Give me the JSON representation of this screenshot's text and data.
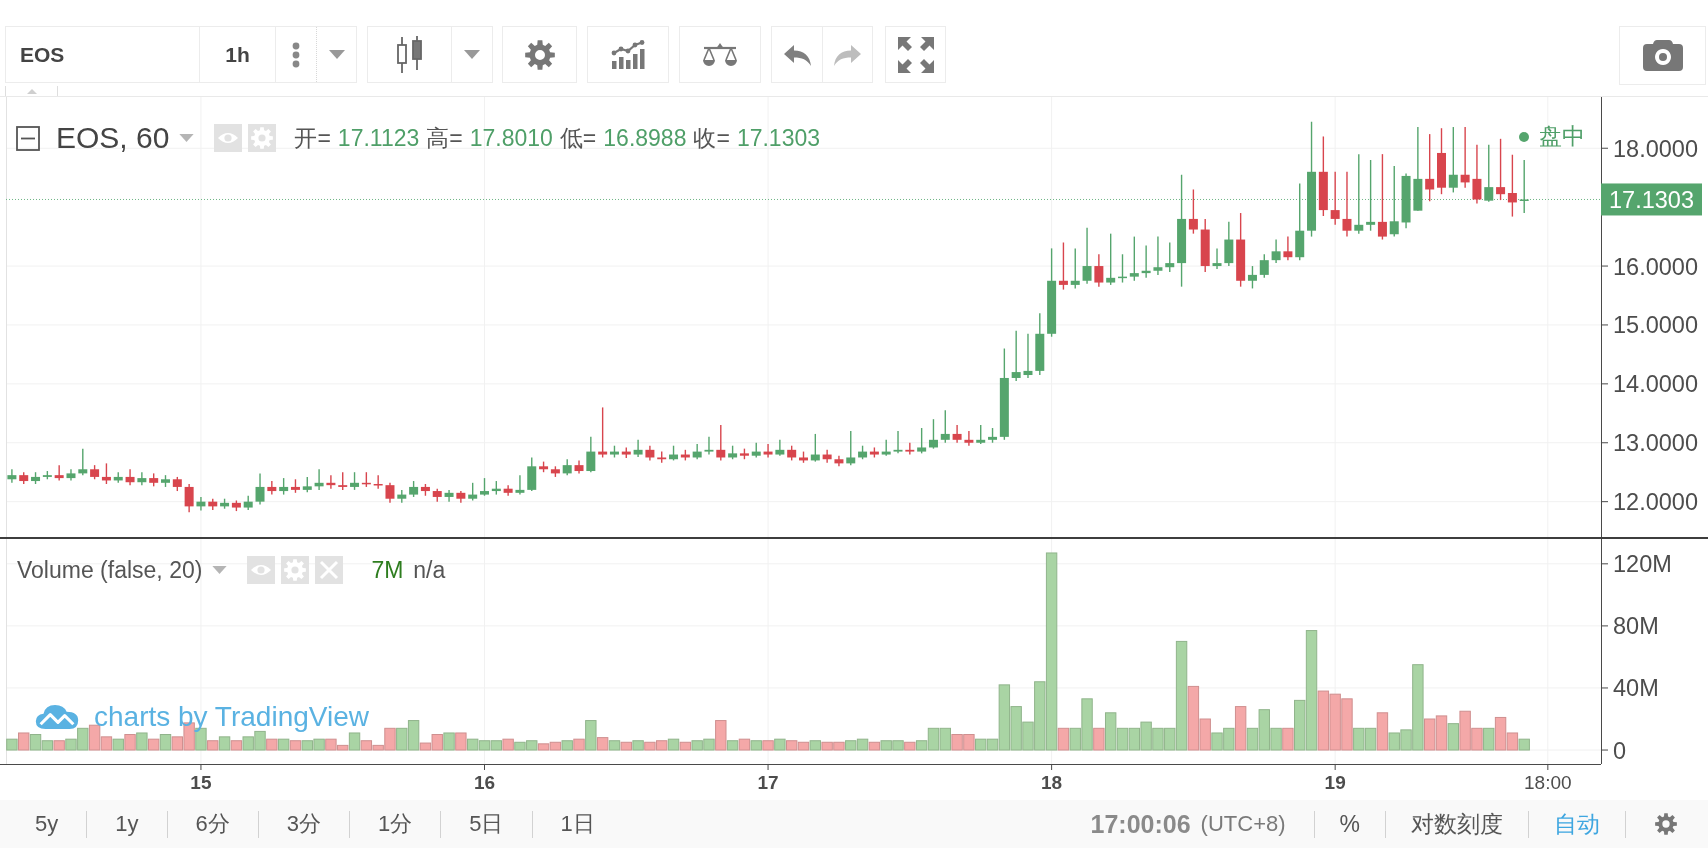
{
  "toolbar": {
    "symbol": "EOS",
    "interval": "1h",
    "undo": {
      "disabled": false
    },
    "redo": {
      "disabled": true
    }
  },
  "price_pane": {
    "legend": {
      "symbol": "EOS, 60",
      "fields": [
        {
          "label": "开=",
          "value": "17.1123"
        },
        {
          "label": "高=",
          "value": "17.8010"
        },
        {
          "label": "低=",
          "value": "16.8988"
        },
        {
          "label": "收=",
          "value": "17.1303"
        }
      ]
    },
    "market_status": "盘中",
    "chart_data": {
      "type": "candlestick",
      "grid": true,
      "ylim": [
        11.4,
        18.87
      ],
      "yticks": [
        {
          "value": 18,
          "label": "18.0000"
        },
        {
          "value": 16,
          "label": "16.0000"
        },
        {
          "value": 15,
          "label": "15.0000"
        },
        {
          "value": 14,
          "label": "14.0000"
        },
        {
          "value": 13,
          "label": "13.0000"
        },
        {
          "value": 12,
          "label": "12.0000"
        }
      ],
      "ref_lines": [
        {
          "axis": "y",
          "value": 17.1303,
          "label": "17.1303"
        }
      ],
      "categories": [
        null,
        null,
        null,
        null,
        null,
        null,
        null,
        null,
        null,
        null,
        null,
        null,
        null,
        null,
        null,
        null,
        null,
        null,
        null,
        null,
        null,
        null,
        null,
        null,
        null,
        null,
        null,
        null,
        null,
        null,
        null,
        null,
        null,
        null,
        null,
        null,
        null,
        null,
        null,
        null,
        null,
        null,
        null,
        null,
        null,
        null,
        null,
        null,
        null,
        null,
        null,
        null,
        null,
        null,
        null,
        null,
        null,
        null,
        null,
        null,
        null,
        null,
        null,
        null,
        null,
        null,
        null,
        null,
        null,
        null,
        null,
        null,
        null,
        null,
        null,
        null,
        null,
        null,
        null,
        null,
        null,
        null,
        null,
        null,
        null,
        null,
        null,
        null,
        null,
        null,
        null,
        null,
        null,
        null,
        null,
        null,
        null,
        null,
        null,
        null,
        null,
        null,
        null,
        null,
        null,
        null,
        null,
        null,
        null,
        null,
        null,
        null,
        null,
        null,
        null,
        null,
        null,
        null,
        null,
        null,
        null,
        null,
        null,
        null,
        null,
        null,
        null,
        null,
        null,
        null,
        null,
        null,
        null,
        null,
        null
      ],
      "ohlc": [
        [
          12.38,
          12.55,
          12.32,
          12.45
        ],
        [
          12.45,
          12.5,
          12.3,
          12.35
        ],
        [
          12.35,
          12.5,
          12.3,
          12.42
        ],
        [
          12.42,
          12.52,
          12.38,
          12.45
        ],
        [
          12.45,
          12.62,
          12.36,
          12.4
        ],
        [
          12.4,
          12.55,
          12.36,
          12.48
        ],
        [
          12.48,
          12.9,
          12.45,
          12.55
        ],
        [
          12.55,
          12.62,
          12.38,
          12.42
        ],
        [
          12.42,
          12.65,
          12.3,
          12.36
        ],
        [
          12.36,
          12.5,
          12.32,
          12.42
        ],
        [
          12.42,
          12.55,
          12.28,
          12.33
        ],
        [
          12.33,
          12.5,
          12.28,
          12.4
        ],
        [
          12.4,
          12.48,
          12.26,
          12.32
        ],
        [
          12.32,
          12.45,
          12.25,
          12.38
        ],
        [
          12.38,
          12.42,
          12.18,
          12.25
        ],
        [
          12.25,
          12.3,
          11.82,
          11.92
        ],
        [
          11.92,
          12.08,
          11.85,
          12.0
        ],
        [
          12.0,
          12.05,
          11.86,
          11.92
        ],
        [
          11.92,
          12.05,
          11.88,
          11.98
        ],
        [
          11.98,
          12.02,
          11.84,
          11.9
        ],
        [
          11.9,
          12.1,
          11.86,
          12.0
        ],
        [
          12.0,
          12.48,
          11.95,
          12.25
        ],
        [
          12.25,
          12.35,
          12.12,
          12.18
        ],
        [
          12.18,
          12.4,
          12.12,
          12.25
        ],
        [
          12.25,
          12.38,
          12.15,
          12.2
        ],
        [
          12.2,
          12.42,
          12.16,
          12.26
        ],
        [
          12.26,
          12.55,
          12.2,
          12.32
        ],
        [
          12.32,
          12.45,
          12.22,
          12.28
        ],
        [
          12.28,
          12.5,
          12.2,
          12.25
        ],
        [
          12.25,
          12.5,
          12.2,
          12.32
        ],
        [
          12.32,
          12.5,
          12.25,
          12.3
        ],
        [
          12.3,
          12.45,
          12.22,
          12.28
        ],
        [
          12.28,
          12.32,
          11.98,
          12.05
        ],
        [
          12.05,
          12.2,
          11.98,
          12.12
        ],
        [
          12.12,
          12.35,
          12.08,
          12.25
        ],
        [
          12.25,
          12.3,
          12.1,
          12.18
        ],
        [
          12.18,
          12.22,
          12.0,
          12.08
        ],
        [
          12.08,
          12.2,
          12.0,
          12.15
        ],
        [
          12.15,
          12.18,
          11.98,
          12.05
        ],
        [
          12.05,
          12.32,
          12.02,
          12.12
        ],
        [
          12.12,
          12.4,
          12.1,
          12.18
        ],
        [
          12.18,
          12.35,
          12.12,
          12.22
        ],
        [
          12.22,
          12.28,
          12.1,
          12.15
        ],
        [
          12.15,
          12.45,
          12.12,
          12.2
        ],
        [
          12.2,
          12.75,
          12.18,
          12.6
        ],
        [
          12.6,
          12.68,
          12.5,
          12.55
        ],
        [
          12.55,
          12.6,
          12.42,
          12.48
        ],
        [
          12.48,
          12.72,
          12.45,
          12.62
        ],
        [
          12.62,
          12.7,
          12.48,
          12.52
        ],
        [
          12.52,
          13.1,
          12.5,
          12.85
        ],
        [
          12.85,
          13.6,
          12.75,
          12.8
        ],
        [
          12.8,
          12.95,
          12.75,
          12.85
        ],
        [
          12.85,
          12.92,
          12.74,
          12.8
        ],
        [
          12.8,
          13.05,
          12.76,
          12.88
        ],
        [
          12.88,
          12.95,
          12.7,
          12.75
        ],
        [
          12.75,
          12.85,
          12.66,
          12.72
        ],
        [
          12.72,
          12.95,
          12.7,
          12.8
        ],
        [
          12.8,
          12.88,
          12.7,
          12.75
        ],
        [
          12.75,
          12.98,
          12.72,
          12.85
        ],
        [
          12.85,
          13.1,
          12.8,
          12.88
        ],
        [
          12.88,
          13.3,
          12.7,
          12.75
        ],
        [
          12.75,
          12.95,
          12.72,
          12.82
        ],
        [
          12.82,
          12.9,
          12.72,
          12.78
        ],
        [
          12.78,
          13.0,
          12.75,
          12.85
        ],
        [
          12.85,
          12.98,
          12.75,
          12.8
        ],
        [
          12.8,
          13.05,
          12.78,
          12.88
        ],
        [
          12.88,
          12.95,
          12.7,
          12.75
        ],
        [
          12.75,
          12.85,
          12.66,
          12.7
        ],
        [
          12.7,
          13.15,
          12.68,
          12.8
        ],
        [
          12.8,
          12.88,
          12.66,
          12.72
        ],
        [
          12.72,
          12.78,
          12.6,
          12.65
        ],
        [
          12.65,
          13.2,
          12.62,
          12.75
        ],
        [
          12.75,
          12.95,
          12.72,
          12.85
        ],
        [
          12.85,
          12.92,
          12.75,
          12.8
        ],
        [
          12.8,
          13.05,
          12.78,
          12.85
        ],
        [
          12.85,
          13.2,
          12.82,
          12.88
        ],
        [
          12.88,
          13.0,
          12.8,
          12.85
        ],
        [
          12.85,
          13.25,
          12.82,
          12.92
        ],
        [
          12.92,
          13.4,
          12.9,
          13.05
        ],
        [
          13.05,
          13.55,
          13.0,
          13.15
        ],
        [
          13.15,
          13.3,
          13.0,
          13.05
        ],
        [
          13.05,
          13.2,
          12.95,
          13.0
        ],
        [
          13.0,
          13.3,
          12.98,
          13.05
        ],
        [
          13.05,
          13.25,
          13.0,
          13.1
        ],
        [
          13.1,
          14.6,
          13.05,
          14.1
        ],
        [
          14.1,
          14.9,
          14.05,
          14.2
        ],
        [
          14.15,
          14.85,
          14.1,
          14.22
        ],
        [
          14.22,
          15.2,
          14.15,
          14.85
        ],
        [
          14.85,
          16.3,
          14.8,
          15.75
        ],
        [
          15.75,
          16.4,
          15.6,
          15.68
        ],
        [
          15.68,
          16.3,
          15.62,
          15.75
        ],
        [
          15.75,
          16.65,
          15.7,
          16.0
        ],
        [
          16.0,
          16.2,
          15.65,
          15.72
        ],
        [
          15.72,
          16.55,
          15.68,
          15.8
        ],
        [
          15.8,
          16.2,
          15.72,
          15.82
        ],
        [
          15.82,
          16.5,
          15.75,
          15.88
        ],
        [
          15.88,
          16.35,
          15.8,
          15.92
        ],
        [
          15.92,
          16.5,
          15.85,
          15.98
        ],
        [
          15.98,
          16.4,
          15.9,
          16.05
        ],
        [
          16.05,
          17.55,
          15.65,
          16.8
        ],
        [
          16.8,
          17.3,
          16.55,
          16.62
        ],
        [
          16.62,
          16.8,
          15.9,
          16.0
        ],
        [
          16.0,
          16.3,
          15.95,
          16.05
        ],
        [
          16.05,
          16.75,
          16.0,
          16.45
        ],
        [
          16.45,
          16.9,
          15.65,
          15.75
        ],
        [
          15.75,
          16.0,
          15.62,
          15.85
        ],
        [
          15.85,
          16.2,
          15.8,
          16.1
        ],
        [
          16.1,
          16.45,
          16.05,
          16.25
        ],
        [
          16.25,
          16.5,
          16.1,
          16.15
        ],
        [
          16.15,
          17.4,
          16.1,
          16.6
        ],
        [
          16.6,
          18.45,
          16.5,
          17.6
        ],
        [
          17.6,
          18.2,
          16.85,
          16.95
        ],
        [
          16.95,
          17.6,
          16.7,
          16.8
        ],
        [
          16.8,
          17.6,
          16.5,
          16.6
        ],
        [
          16.6,
          17.9,
          16.55,
          16.7
        ],
        [
          16.7,
          17.8,
          16.6,
          16.75
        ],
        [
          16.75,
          17.9,
          16.45,
          16.5
        ],
        [
          16.54,
          17.7,
          16.5,
          16.76
        ],
        [
          16.74,
          17.57,
          16.64,
          17.53
        ],
        [
          16.94,
          18.36,
          16.94,
          17.48
        ],
        [
          17.48,
          18.24,
          17.1,
          17.3
        ],
        [
          17.92,
          18.34,
          17.22,
          17.33
        ],
        [
          17.33,
          18.36,
          17.25,
          17.55
        ],
        [
          17.55,
          18.36,
          17.33,
          17.42
        ],
        [
          17.48,
          18.06,
          17.06,
          17.13
        ],
        [
          17.11,
          18.06,
          17.09,
          17.34
        ],
        [
          17.34,
          18.16,
          17.12,
          17.22
        ],
        [
          17.24,
          17.89,
          16.84,
          17.08
        ],
        [
          17.1123,
          17.801,
          16.8988,
          17.1303
        ],
        null,
        null,
        null,
        null,
        null,
        null
      ]
    }
  },
  "volume_pane": {
    "legend": {
      "title": "Volume (false, 20)",
      "value": "7M",
      "extra": "n/a"
    },
    "chart_data": {
      "type": "bar",
      "stacked": true,
      "grid": true,
      "ylim": [
        -9,
        136
      ],
      "categories": [
        null,
        null,
        null,
        null,
        null,
        null,
        null,
        null,
        null,
        null,
        null,
        null,
        null,
        null,
        null,
        null,
        "15",
        null,
        null,
        null,
        null,
        null,
        null,
        null,
        null,
        null,
        null,
        null,
        null,
        null,
        null,
        null,
        null,
        null,
        null,
        null,
        null,
        null,
        null,
        null,
        "16",
        null,
        null,
        null,
        null,
        null,
        null,
        null,
        null,
        null,
        null,
        null,
        null,
        null,
        null,
        null,
        null,
        null,
        null,
        null,
        null,
        null,
        null,
        null,
        "17",
        null,
        null,
        null,
        null,
        null,
        null,
        null,
        null,
        null,
        null,
        null,
        null,
        null,
        null,
        null,
        null,
        null,
        null,
        null,
        null,
        null,
        null,
        null,
        "18",
        null,
        null,
        null,
        null,
        null,
        null,
        null,
        null,
        null,
        null,
        null,
        null,
        null,
        null,
        null,
        null,
        null,
        null,
        null,
        null,
        null,
        null,
        null,
        "19",
        null,
        null,
        null,
        null,
        null,
        null,
        null,
        null,
        null,
        null,
        null,
        null,
        null,
        null,
        null,
        null,
        null,
        "18:00",
        null,
        null,
        null,
        null
      ],
      "yticks": [
        {
          "value": 0,
          "label": "0"
        },
        {
          "value": 40,
          "label": "40M"
        },
        {
          "value": 80,
          "label": "80M"
        },
        {
          "value": 120,
          "label": "120M"
        }
      ],
      "series": [
        {
          "color": "#a9d4a4",
          "values": [
            7,
            null,
            10,
            6,
            null,
            7,
            14,
            null,
            null,
            7,
            null,
            11,
            null,
            10,
            null,
            null,
            14,
            null,
            8.5,
            null,
            8.5,
            12,
            null,
            7,
            null,
            6,
            7,
            null,
            null,
            11,
            null,
            null,
            null,
            14,
            19,
            null,
            null,
            11,
            null,
            7,
            6,
            6,
            null,
            5,
            6,
            null,
            null,
            6,
            null,
            19,
            null,
            6,
            null,
            6,
            null,
            null,
            7,
            null,
            6,
            7,
            null,
            6,
            null,
            6,
            null,
            7,
            null,
            null,
            6,
            null,
            null,
            6,
            7,
            null,
            6,
            6,
            null,
            6,
            14,
            14,
            null,
            null,
            7,
            7,
            42,
            28,
            18,
            44,
            127,
            null,
            14,
            33,
            null,
            24,
            14,
            14,
            18,
            14,
            14,
            70,
            null,
            null,
            11,
            14,
            null,
            14,
            26,
            14,
            null,
            32,
            77,
            null,
            null,
            null,
            14,
            14,
            null,
            11,
            13,
            55,
            null,
            null,
            17,
            null,
            null,
            14,
            null,
            null,
            7,
            null,
            null,
            null,
            null,
            null,
            null
          ]
        },
        {
          "color": "#f4a8a8",
          "values": [
            null,
            11,
            null,
            null,
            6,
            null,
            null,
            16,
            8.5,
            null,
            10,
            null,
            7,
            null,
            8.5,
            17.5,
            null,
            6,
            null,
            6,
            null,
            null,
            7,
            null,
            6,
            null,
            null,
            7,
            3,
            null,
            6,
            3,
            14,
            null,
            null,
            4.5,
            10,
            null,
            11,
            null,
            null,
            null,
            7,
            null,
            null,
            4,
            5,
            null,
            7,
            null,
            8,
            null,
            5,
            null,
            5,
            6,
            null,
            5,
            null,
            null,
            19,
            null,
            7,
            null,
            6,
            null,
            6,
            5,
            null,
            5,
            5,
            null,
            null,
            5,
            null,
            null,
            5,
            null,
            null,
            null,
            10,
            10,
            null,
            null,
            null,
            null,
            null,
            null,
            null,
            14,
            null,
            null,
            14,
            null,
            null,
            null,
            null,
            null,
            null,
            null,
            41,
            20,
            null,
            null,
            28,
            null,
            null,
            null,
            14,
            null,
            null,
            38,
            36,
            33,
            null,
            null,
            24,
            null,
            null,
            null,
            20,
            22,
            null,
            25,
            14,
            null,
            21,
            11,
            null,
            null,
            null,
            null,
            null,
            null,
            null
          ]
        }
      ]
    }
  },
  "branding": "charts by TradingView",
  "bottom_bar": {
    "ranges": [
      "5y",
      "1y",
      "6分",
      "3分",
      "1分",
      "5日",
      "1日"
    ],
    "clock": "17:00:06",
    "timezone": "(UTC+8)",
    "options": [
      {
        "label": "%",
        "selected": false
      },
      {
        "label": "对数刻度",
        "selected": false
      },
      {
        "label": "自动",
        "selected": true
      }
    ]
  }
}
